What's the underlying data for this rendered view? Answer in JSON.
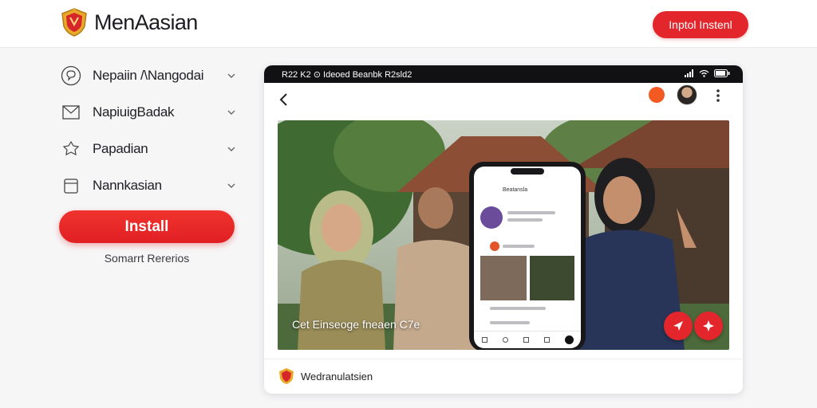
{
  "header": {
    "brand": "MenAasian",
    "install_button": "Inptol Instenl"
  },
  "sidebar": {
    "items": [
      {
        "label": "Nepaiin /\\Nangodai",
        "icon": "chat-bubble-icon"
      },
      {
        "label": "NapiuigBadak",
        "icon": "envelope-icon"
      },
      {
        "label": "Papadian",
        "icon": "shapes-icon"
      },
      {
        "label": "Nannkasian",
        "icon": "bag-icon"
      }
    ],
    "install_label": "Install",
    "sub_link": "Somarrt Rererios"
  },
  "device": {
    "status_text": "R22 K2 ⊙ Ideoed Beanbk R2sld2",
    "caption": "Cet Einseoge fneaen C7e",
    "phone_screen_title": "Beatansla",
    "footer_label": "Wedranulatsien"
  },
  "colors": {
    "accent": "#e3262b",
    "text": "#1e1e22",
    "background": "#f6f6f7"
  }
}
